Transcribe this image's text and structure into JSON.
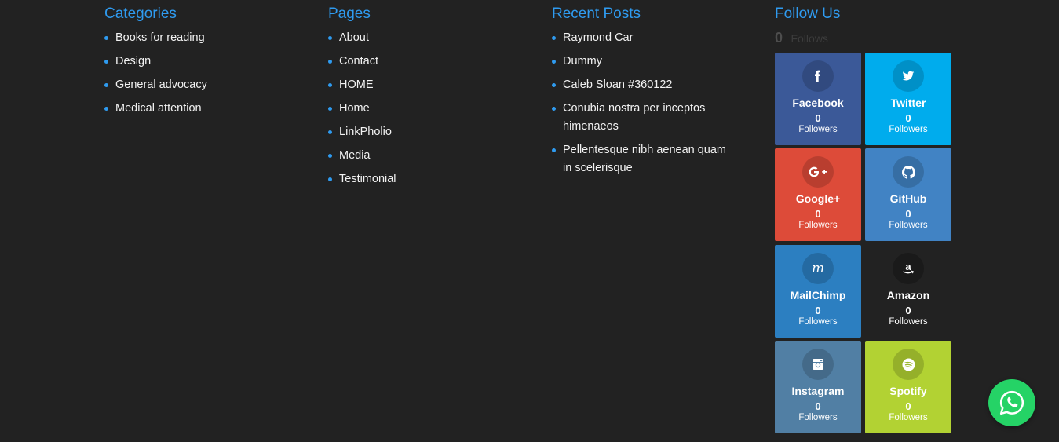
{
  "categories": {
    "title": "Categories",
    "items": [
      "Books for reading",
      "Design",
      "General advocacy",
      "Medical attention"
    ]
  },
  "pages": {
    "title": "Pages",
    "items": [
      "About",
      "Contact",
      "HOME",
      "Home",
      "LinkPholio",
      "Media",
      "Testimonial"
    ]
  },
  "recent_posts": {
    "title": "Recent Posts",
    "items": [
      "Raymond Car",
      "Dummy",
      "Caleb Sloan #360122",
      "Conubia nostra per inceptos himenaeos",
      "Pellentesque nibh aenean quam in scelerisque"
    ]
  },
  "follow_us": {
    "title": "Follow Us",
    "total_count": "0",
    "total_label": "Follows",
    "networks": [
      {
        "name": "Facebook",
        "count": "0",
        "label": "Followers",
        "color": "#3b5998",
        "icon": "facebook-icon"
      },
      {
        "name": "Twitter",
        "count": "0",
        "label": "Followers",
        "color": "#00aced",
        "icon": "twitter-icon"
      },
      {
        "name": "Google+",
        "count": "0",
        "label": "Followers",
        "color": "#dd4b39",
        "icon": "google-plus-icon"
      },
      {
        "name": "GitHub",
        "count": "0",
        "label": "Followers",
        "color": "#4183c4",
        "icon": "github-icon"
      },
      {
        "name": "MailChimp",
        "count": "0",
        "label": "Followers",
        "color": "#2c7fc1",
        "icon": "mailchimp-icon"
      },
      {
        "name": "Amazon",
        "count": "0",
        "label": "Followers",
        "color": "#222222",
        "icon": "amazon-icon"
      },
      {
        "name": "Instagram",
        "count": "0",
        "label": "Followers",
        "color": "#517fa4",
        "icon": "instagram-icon"
      },
      {
        "name": "Spotify",
        "count": "0",
        "label": "Followers",
        "color": "#b2d233",
        "icon": "spotify-icon"
      }
    ]
  },
  "whatsapp": {
    "icon": "whatsapp-icon",
    "color": "#25d366"
  }
}
